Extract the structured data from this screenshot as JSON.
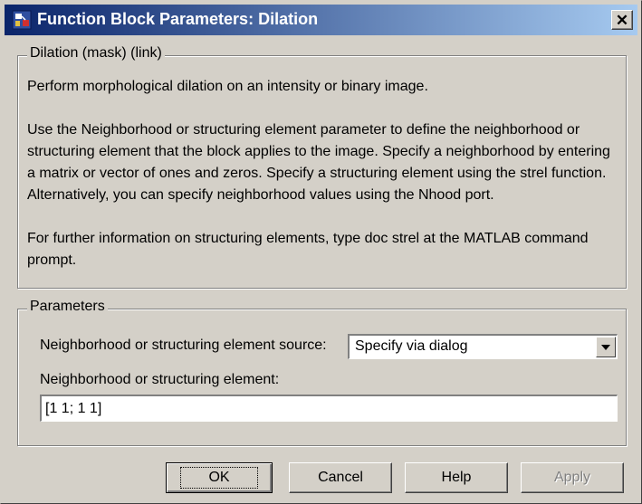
{
  "window": {
    "title": "Function Block Parameters: Dilation"
  },
  "icons": {
    "app": "block-diagram-icon",
    "close": "close-icon",
    "dropdown": "dropdown-arrow-icon"
  },
  "description": {
    "legend": "Dilation (mask) (link)",
    "paragraphs": [
      "Perform morphological dilation on an intensity or binary image.",
      "Use the Neighborhood or structuring element parameter to define the neighborhood or structuring element that the block applies to the image.  Specify a neighborhood by entering a matrix or vector of ones and zeros.  Specify a structuring element using the strel function.  Alternatively, you can specify neighborhood values using the Nhood port.",
      "For further information on structuring elements, type doc strel at the MATLAB command prompt."
    ]
  },
  "parameters": {
    "legend": "Parameters",
    "source_label": "Neighborhood or structuring element source:",
    "source_value": "Specify via dialog",
    "element_label": "Neighborhood or structuring element:",
    "element_value": "[1 1; 1 1]"
  },
  "buttons": {
    "ok": "OK",
    "cancel": "Cancel",
    "help": "Help",
    "apply": "Apply"
  }
}
